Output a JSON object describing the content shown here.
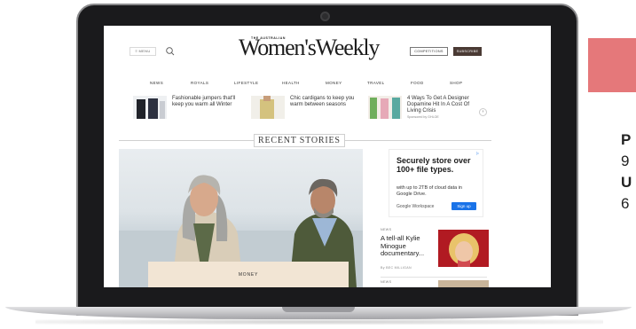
{
  "site": {
    "logo_small": "THE AUSTRALIAN",
    "logo": "Women'sWeekly",
    "menu_label": "MENU",
    "competitions_label": "COMPETITIONS",
    "subscribe_label": "SUBSCRIBE"
  },
  "nav": [
    "NEWS",
    "ROYALS",
    "LIFESTYLE",
    "HEALTH",
    "MONEY",
    "TRAVEL",
    "FOOD",
    "SHOP"
  ],
  "promos": [
    {
      "text": "Fashionable jumpers that'll keep you warm all Winter"
    },
    {
      "text": "Chic cardigans to keep you warm between seasons"
    },
    {
      "text": "4 Ways To Get A Designer Dopamine Hit In A Cost Of Living Crisis",
      "sponsor": "Sponsored by GHLOE"
    }
  ],
  "promo_arrow": "›",
  "section_title": "RECENT STORIES",
  "hero": {
    "category": "MONEY"
  },
  "ad": {
    "headline": "Securely store over 100+ file types.",
    "sub": "with up to 2TB of cloud data in Google Drive.",
    "brand": "Google Workspace",
    "button": "Sign up",
    "choices": "▷"
  },
  "stories": [
    {
      "tag": "NEWS",
      "title": "A tell-all Kylie Minogue documentary...",
      "author": "By BEC MILLIGAN"
    },
    {
      "tag": "NEWS"
    }
  ],
  "side_panel": {
    "line1": "P",
    "line2": "9",
    "line3": "U",
    "line4": "6",
    "accent_color": "#e5787a"
  }
}
